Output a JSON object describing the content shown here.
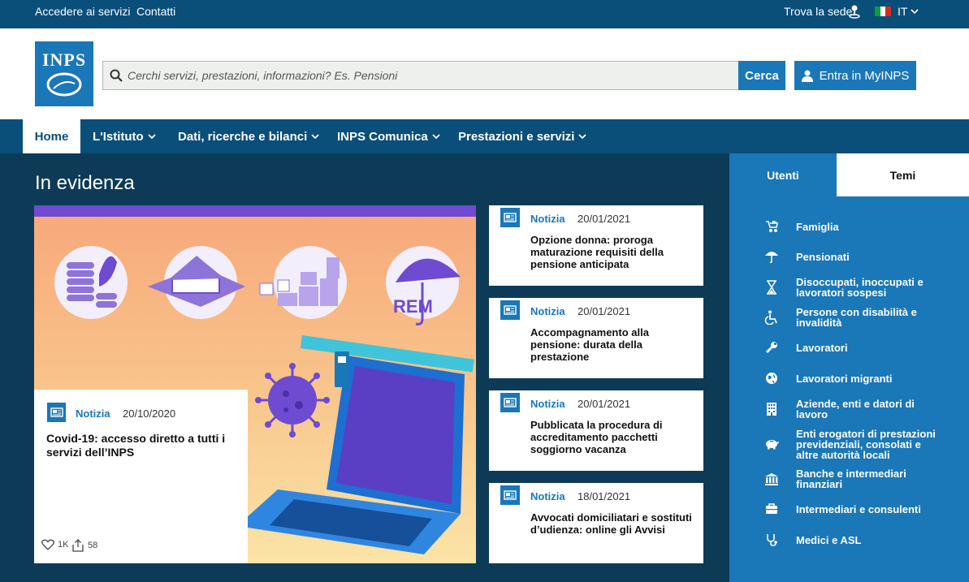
{
  "topbar": {
    "access": "Accedere ai servizi",
    "contacts": "Contatti",
    "find_office": "Trova la sede",
    "language": "IT"
  },
  "header": {
    "logo_text": "INPS",
    "search_placeholder": "Cerchi servizi, prestazioni, informazioni? Es. Pensioni",
    "search_button": "Cerca",
    "login_button": "Entra in MyINPS"
  },
  "nav": {
    "home": "Home",
    "istituto": "L'Istituto",
    "dati": "Dati, ricerche e bilanci",
    "comunica": "INPS Comunica",
    "prestazioni": "Prestazioni e servizi"
  },
  "section": {
    "title": "In evidenza"
  },
  "hero": {
    "tag": "Notizia",
    "date": "20/10/2020",
    "title": "Covid-19: accesso diretto a tutti i servizi dell’INPS",
    "likes": "1K",
    "shares": "58",
    "illustration_text": "REM"
  },
  "news": [
    {
      "tag": "Notizia",
      "date": "20/01/2021",
      "title": "Opzione donna: proroga maturazione requisiti della pensione anticipata"
    },
    {
      "tag": "Notizia",
      "date": "20/01/2021",
      "title": "Accompagnamento alla pensione: durata della prestazione"
    },
    {
      "tag": "Notizia",
      "date": "20/01/2021",
      "title": "Pubblicata la procedura di accreditamento pacchetti soggiorno vacanza"
    },
    {
      "tag": "Notizia",
      "date": "18/01/2021",
      "title": "Avvocati domiciliatari e sostituti d’udienza: online gli Avvisi"
    }
  ],
  "panel": {
    "tabs": [
      "Utenti",
      "Temi"
    ],
    "items": [
      {
        "label": "Famiglia",
        "icon": "stroller-icon"
      },
      {
        "label": "Pensionati",
        "icon": "umbrella-icon"
      },
      {
        "label": "Disoccupati, inoccupati e lavoratori sospesi",
        "icon": "hourglass-icon"
      },
      {
        "label": "Persone con disabilità e invalidità",
        "icon": "wheelchair-icon"
      },
      {
        "label": "Lavoratori",
        "icon": "wrench-icon"
      },
      {
        "label": "Lavoratori migranti",
        "icon": "globe-icon"
      },
      {
        "label": "Aziende, enti e datori di lavoro",
        "icon": "building-icon"
      },
      {
        "label": "Enti erogatori di prestazioni previdenziali, consolati e altre autorità locali",
        "icon": "piggy-bank-icon"
      },
      {
        "label": "Banche e intermediari finanziari",
        "icon": "bank-icon"
      },
      {
        "label": "Intermediari e consulenti",
        "icon": "briefcase-icon"
      },
      {
        "label": "Medici e ASL",
        "icon": "stethoscope-icon"
      }
    ]
  },
  "colors": {
    "primary": "#1a77b8",
    "dark_bar": "#0a4e7a",
    "page_bg": "#0d3b57"
  }
}
